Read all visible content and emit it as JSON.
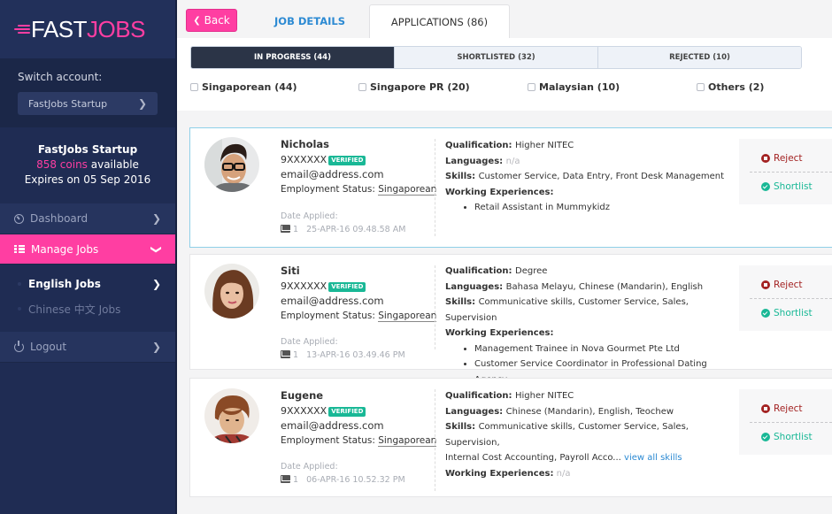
{
  "brand": {
    "logo_part1": "FAST",
    "logo_part2": "J",
    "logo_part3": "OBS",
    "pink": "#ff3ea2",
    "navy": "#1f2c53"
  },
  "sidebar": {
    "switch_account_label": "Switch account:",
    "switch_account_value": "FastJobs Startup",
    "account": {
      "name": "FastJobs Startup",
      "coins": "858 coins",
      "coins_suffix": " available",
      "expiry": "Expires on 05 Sep 2016"
    },
    "nav": [
      {
        "label": "Dashboard",
        "icon": "dashboard-icon"
      },
      {
        "label": "Manage Jobs",
        "icon": "list-icon",
        "active": true
      },
      {
        "label": "Logout",
        "icon": "power-icon"
      }
    ],
    "subnav": [
      {
        "label": "English Jobs",
        "active": true
      },
      {
        "label": "Chinese 中文 Jobs"
      }
    ]
  },
  "topbar": {
    "back_label": "Back",
    "tabs": [
      {
        "label": "JOB DETAILS"
      },
      {
        "label": "APPLICATIONS (86)",
        "active": true
      }
    ]
  },
  "segments": [
    {
      "label": "IN PROGRESS (44)",
      "active": true
    },
    {
      "label": "SHORTLISTED (32)"
    },
    {
      "label": "REJECTED (10)"
    }
  ],
  "filters": [
    {
      "label": "Singaporean (44)",
      "checked": false
    },
    {
      "label": "Singapore PR (20)",
      "checked": false
    },
    {
      "label": "Malaysian (10)",
      "checked": false
    },
    {
      "label": "Others (2)",
      "checked": false
    }
  ],
  "labels": {
    "verified": "VERIFIED",
    "employment_status": "Employment Status: ",
    "date_applied": "Date Applied:",
    "qualification": "Qualification: ",
    "languages": "Languages: ",
    "skills": "Skills: ",
    "working_experiences": "Working Experiences:",
    "reject": "Reject",
    "shortlist": "Shortlist",
    "view_all_skills": "view all skills"
  },
  "applicants": [
    {
      "name": "Nicholas",
      "phone": "9XXXXXX",
      "email": "email@address.com",
      "employment_status": "Singaporean",
      "messages": "1",
      "date_applied": "25-APR-16 09.48.58 AM",
      "qualification": "Higher NITEC",
      "languages": "n/a",
      "skills": "Customer Service, Data Entry, Front Desk Management",
      "experiences": [
        "Retail Assistant in Mummykidz"
      ]
    },
    {
      "name": "Siti",
      "phone": "9XXXXXX",
      "email": "email@address.com",
      "employment_status": "Singaporean",
      "messages": "1",
      "date_applied": "13-APR-16 03.49.46 PM",
      "qualification": "Degree",
      "languages": "Bahasa Melayu, Chinese (Mandarin), English",
      "skills": "Communicative skills, Customer Service, Sales, Supervision",
      "experiences": [
        "Management Trainee in Nova Gourmet Pte Ltd",
        "Customer Service Coordinator in Professional Dating Agency"
      ]
    },
    {
      "name": "Eugene",
      "phone": "9XXXXXX",
      "email": "email@address.com",
      "employment_status": "Singaporean",
      "messages": "1",
      "date_applied": "06-APR-16 10.52.32 PM",
      "qualification": "Higher NITEC",
      "languages": "Chinese (Mandarin), English, Teochew",
      "skills": "Communicative skills, Customer Service, Sales, Supervision,",
      "skills_line2": "Internal Cost Accounting, Payroll Acco...",
      "experiences_text": "n/a"
    }
  ]
}
